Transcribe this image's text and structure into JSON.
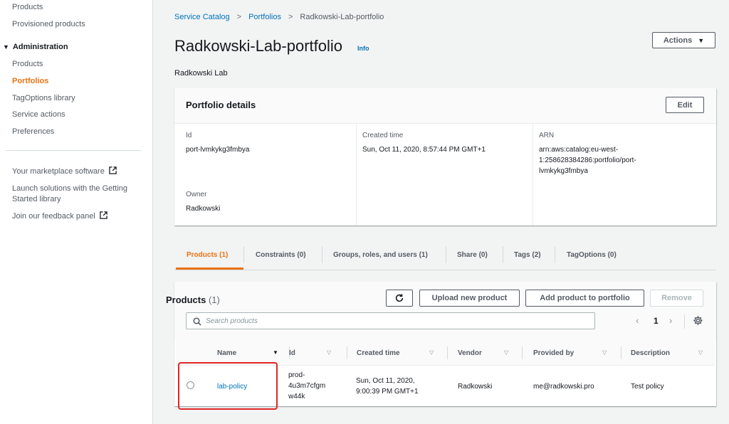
{
  "sidebar": {
    "top_items": [
      "Products",
      "Provisioned products"
    ],
    "admin_heading": "Administration",
    "admin_items": [
      {
        "label": "Products",
        "active": false
      },
      {
        "label": "Portfolios",
        "active": true
      },
      {
        "label": "TagOptions library",
        "active": false
      },
      {
        "label": "Service actions",
        "active": false
      },
      {
        "label": "Preferences",
        "active": false
      }
    ],
    "extra_links": {
      "marketplace": "Your marketplace software",
      "getting_started_1": "Launch solutions with the Getting",
      "getting_started_2": "Started library",
      "feedback": "Join our feedback panel"
    }
  },
  "breadcrumb": {
    "root": "Service Catalog",
    "parent": "Portfolios",
    "current": "Radkowski-Lab-portfolio"
  },
  "header": {
    "title": "Radkowski-Lab-portfolio",
    "info": "Info",
    "subtitle": "Radkowski Lab",
    "actions_label": "Actions"
  },
  "details": {
    "title": "Portfolio details",
    "edit_label": "Edit",
    "id_label": "Id",
    "id_value": "port-lvmkykg3fmbya",
    "created_label": "Created time",
    "created_value": "Sun, Oct 11, 2020, 8:57:44 PM GMT+1",
    "arn_label": "ARN",
    "arn_line1": "arn:aws:catalog:eu-west-",
    "arn_line2": "1:258628384286:portfolio/port-",
    "arn_line3": "lvmkykg3fmbya",
    "owner_label": "Owner",
    "owner_value": "Radkowski"
  },
  "tabs": [
    "Products (1)",
    "Constraints (0)",
    "Groups, roles, and users (1)",
    "Share (0)",
    "Tags (2)",
    "TagOptions (0)"
  ],
  "products": {
    "title": "Products",
    "count": "(1)",
    "upload_label": "Upload new product",
    "add_label": "Add product to portfolio",
    "remove_label": "Remove",
    "search_placeholder": "Search products",
    "page": "1",
    "columns": [
      "Name",
      "Id",
      "Created time",
      "Vendor",
      "Provided by",
      "Description"
    ],
    "row": {
      "name": "lab-policy",
      "id_1": "prod-",
      "id_2": "4u3m7cfgm",
      "id_3": "w44k",
      "created_1": "Sun, Oct 11, 2020,",
      "created_2": "9:00:39 PM GMT+1",
      "vendor": "Radkowski",
      "provided_by": "me@radkowski.pro",
      "description": "Test policy"
    }
  },
  "colors": {
    "accent": "#ec7211",
    "link": "#0073bb",
    "highlight": "#e02525"
  }
}
